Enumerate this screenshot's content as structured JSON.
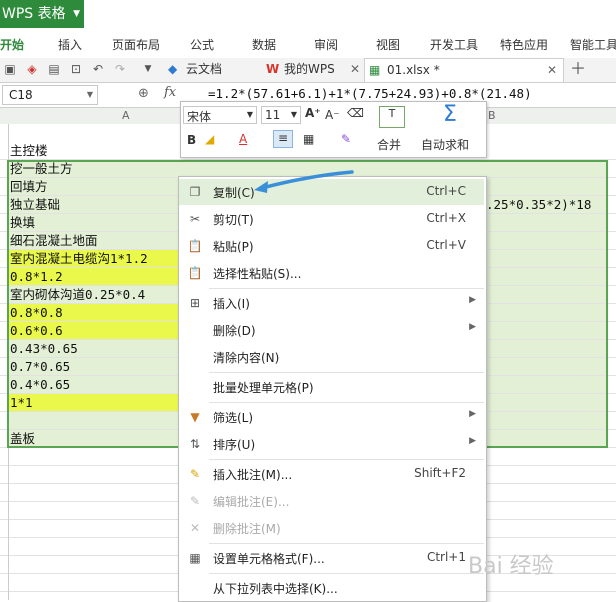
{
  "app": {
    "title": "WPS 表格"
  },
  "menu": [
    "开始",
    "插入",
    "页面布局",
    "公式",
    "数据",
    "审阅",
    "视图",
    "开发工具",
    "特色应用",
    "智能工具"
  ],
  "doc_tabs": [
    {
      "label": "云文档"
    },
    {
      "label": "我的WPS"
    },
    {
      "label": "01.xlsx *"
    }
  ],
  "formula_bar": {
    "cell_ref": "C18",
    "fx": "fx",
    "formula": "=1.2*(57.61+6.1)+1*(7.75+24.93)+0.8*(21.48)"
  },
  "columns": {
    "a": "A",
    "b": "B"
  },
  "rows": [
    "主控楼",
    "挖一般土方",
    "回填方",
    "独立基础",
    "换填",
    "细石混凝土地面",
    "室内混凝土电缆沟1*1.2",
    "0.8*1.2",
    "室内砌体沟道0.25*0.4",
    "0.8*0.8",
    "0.6*0.6",
    "0.43*0.65",
    "0.7*0.65",
    "0.4*0.65",
    "1*1",
    "",
    "盖板"
  ],
  "row3_partial": ".25*0.35*2)*18",
  "mini_toolbar": {
    "font_name": "宋体",
    "font_size": "11",
    "merge_label": "合并",
    "autosum_label": "自动求和"
  },
  "context_menu": [
    {
      "icon": "copy-icon",
      "label": "复制(C)",
      "shortcut": "Ctrl+C"
    },
    {
      "icon": "cut-icon",
      "label": "剪切(T)",
      "shortcut": "Ctrl+X"
    },
    {
      "icon": "paste-icon",
      "label": "粘贴(P)",
      "shortcut": "Ctrl+V"
    },
    {
      "icon": "paste-special-icon",
      "label": "选择性粘贴(S)...",
      "shortcut": ""
    },
    {
      "icon": "insert-icon",
      "label": "插入(I)",
      "shortcut": ""
    },
    {
      "icon": "",
      "label": "删除(D)",
      "shortcut": ""
    },
    {
      "icon": "",
      "label": "清除内容(N)",
      "shortcut": ""
    },
    {
      "icon": "",
      "label": "批量处理单元格(P)",
      "shortcut": ""
    },
    {
      "icon": "filter-icon",
      "label": "筛选(L)",
      "shortcut": ""
    },
    {
      "icon": "sort-icon",
      "label": "排序(U)",
      "shortcut": ""
    },
    {
      "icon": "comment-icon",
      "label": "插入批注(M)...",
      "shortcut": "Shift+F2"
    },
    {
      "icon": "edit-comment-icon",
      "label": "编辑批注(E)...",
      "shortcut": ""
    },
    {
      "icon": "delete-comment-icon",
      "label": "删除批注(M)",
      "shortcut": ""
    },
    {
      "icon": "format-cells-icon",
      "label": "设置单元格格式(F)...",
      "shortcut": "Ctrl+1"
    },
    {
      "icon": "",
      "label": "从下拉列表中选择(K)...",
      "shortcut": ""
    }
  ],
  "colors": {
    "accent": "#2e8b3c",
    "highlight_green": "#e3f0d6",
    "highlight_yellow": "#e9f84a",
    "arrow": "#3a8fd8"
  },
  "watermark": "Bai 经验"
}
